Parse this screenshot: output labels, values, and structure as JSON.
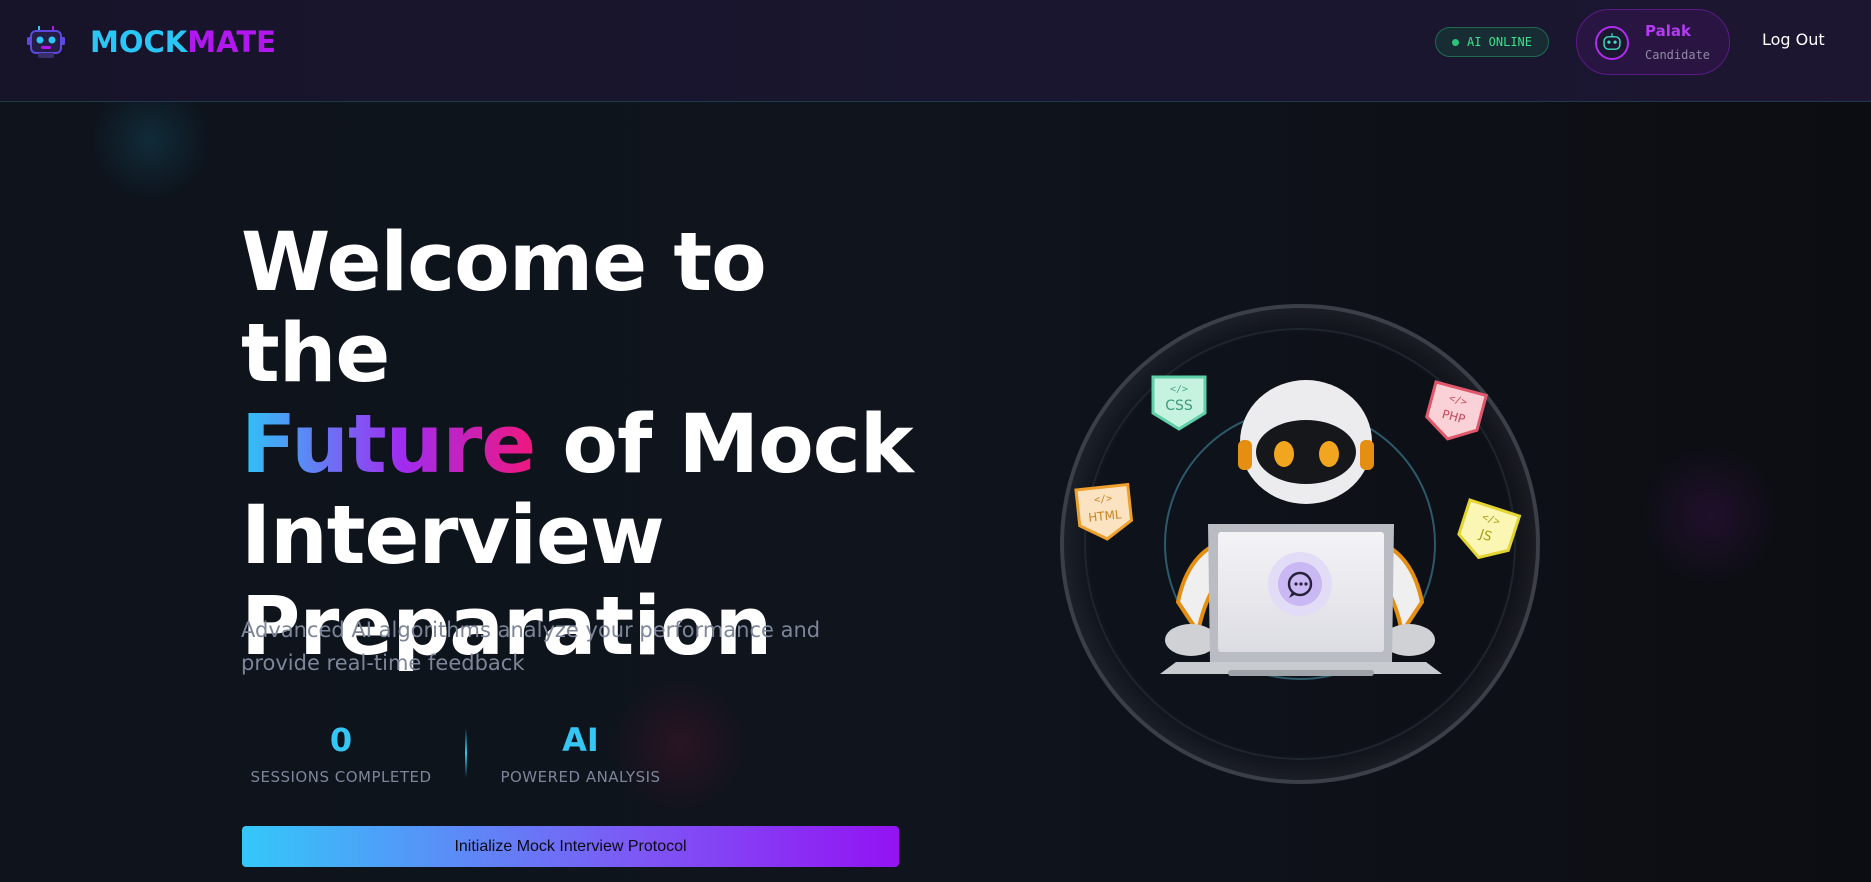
{
  "header": {
    "brand_part1": "MOCK",
    "brand_part2": "MATE",
    "status_badge": "AI ONLINE",
    "user": {
      "name": "Palak",
      "role": "Candidate"
    },
    "logout_label": "Log Out"
  },
  "hero": {
    "title_line1": "Welcome to the",
    "title_highlight": "Future",
    "title_line2_rest": " of Mock",
    "title_line3": "Interview",
    "title_line4": "Preparation",
    "subtitle": "Advanced AI algorithms analyze your performance and provide real-time feedback",
    "stats": [
      {
        "value": "0",
        "label": "SESSIONS COMPLETED"
      },
      {
        "value": "AI",
        "label": "POWERED ANALYSIS"
      }
    ],
    "cta_label": "Initialize Mock Interview Protocol"
  },
  "illustration": {
    "badges": [
      "CSS",
      "PHP",
      "HTML",
      "JS"
    ],
    "icons": [
      "robot-logo-icon",
      "robot-mascot-icon",
      "chat-bubble-icon"
    ]
  },
  "colors": {
    "accent_cyan": "#2ac6f5",
    "accent_purple": "#b217f0",
    "accent_pink": "#f0177c",
    "online_green": "#3fe08c"
  }
}
